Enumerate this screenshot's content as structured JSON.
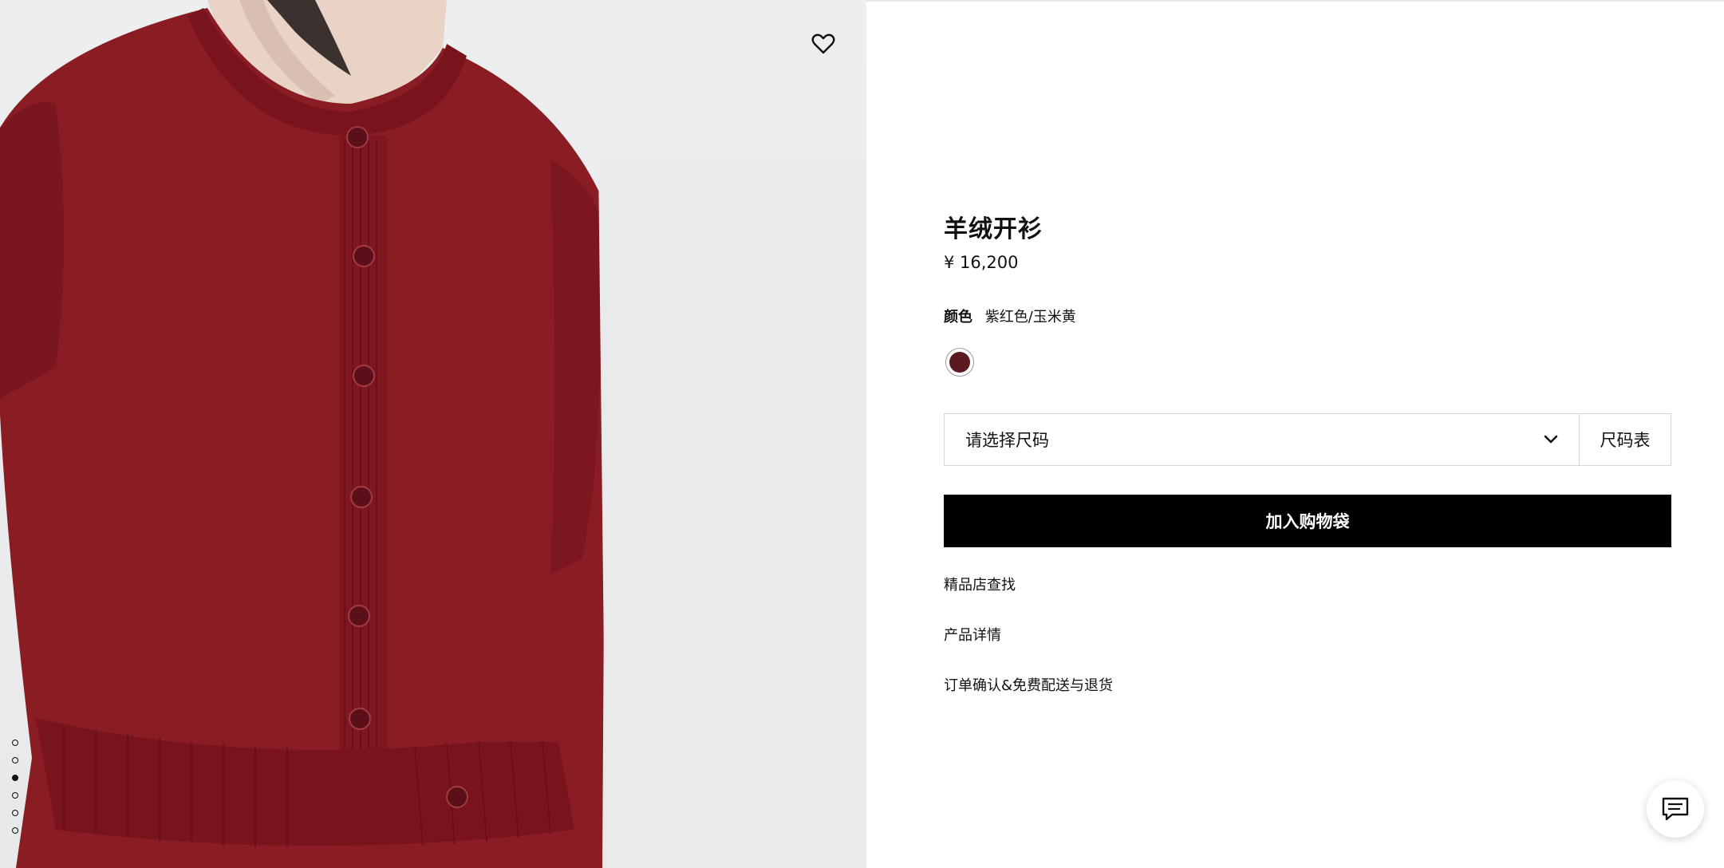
{
  "product": {
    "title": "羊绒开衫",
    "price": "¥ 16,200"
  },
  "color": {
    "label": "颜色",
    "value": "紫红色/玉米黄",
    "swatch_hex": "#5a1a1f"
  },
  "size": {
    "placeholder": "请选择尺码",
    "guide_label": "尺码表"
  },
  "actions": {
    "add_to_bag": "加入购物袋"
  },
  "links": {
    "store_locator": "精品店查找",
    "product_details": "产品详情",
    "order_shipping": "订单确认&免费配送与退货"
  },
  "gallery": {
    "image_count": 6,
    "active_index": 2,
    "garment_color": "#8a1c24"
  },
  "icons": {
    "wishlist": "heart-icon",
    "dropdown": "chevron-down-icon",
    "chat": "chat-icon"
  }
}
